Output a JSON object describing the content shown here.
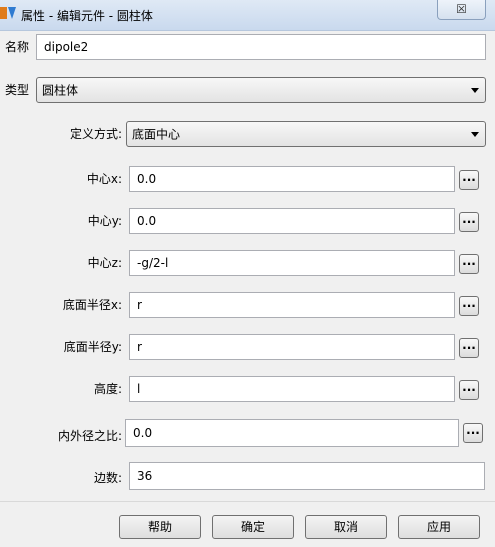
{
  "window": {
    "title": "属性 - 编辑元件 - 圆柱体",
    "close_glyph": "☒"
  },
  "form": {
    "name_label": "名称",
    "name_value": "dipole2",
    "type_label": "类型",
    "type_value": "圆柱体",
    "define_label": "定义方式:",
    "define_value": "底面中心",
    "center_x_label": "中心x:",
    "center_x_value": "0.0",
    "center_y_label": "中心y:",
    "center_y_value": "0.0",
    "center_z_label": "中心z:",
    "center_z_value": "-g/2-l",
    "radius_x_label": "底面半径x:",
    "radius_x_value": "r",
    "radius_y_label": "底面半径y:",
    "radius_y_value": "r",
    "height_label": "高度:",
    "height_value": "l",
    "ratio_label": "内外径之比:",
    "ratio_value": "0.0",
    "edges_label": "边数:",
    "edges_value": "36",
    "browse_glyph": "..."
  },
  "buttons": {
    "help": "帮助",
    "ok": "确定",
    "cancel": "取消",
    "apply": "应用"
  },
  "colors": {
    "titlebar": "#c9d9ee",
    "dialog_bg": "#f0f0f0",
    "field_border": "#abadb3"
  },
  "icons": [
    "app-icon",
    "close-icon",
    "dropdown-arrow-icon",
    "browse-icon"
  ]
}
